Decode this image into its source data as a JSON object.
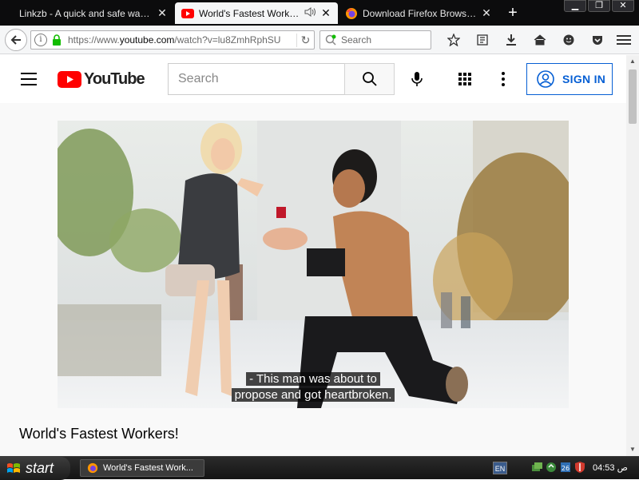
{
  "browser": {
    "tabs": [
      {
        "title": "Linkzb - A quick and safe way to ...",
        "active": false,
        "favicon": "none"
      },
      {
        "title": "World's Fastest Workers!...",
        "active": true,
        "favicon": "youtube-icon",
        "audio": true
      },
      {
        "title": "Download Firefox Browser — ...",
        "active": false,
        "favicon": "firefox-icon"
      }
    ],
    "url_prefix": "https://www.",
    "url_domain": "youtube.com",
    "url_path": "/watch?v=lu8ZmhRphSU",
    "search_placeholder": "Search",
    "window_controls": [
      "minimize",
      "restore",
      "close"
    ]
  },
  "youtube": {
    "logo_text": "YouTube",
    "search_placeholder": "Search",
    "signin_label": "SIGN IN",
    "caption_line1": "- This man was about to",
    "caption_line2": "propose and got heartbroken.",
    "video_title": "World's Fastest Workers!",
    "brand_color": "#ff0000",
    "link_color": "#065fd4"
  },
  "taskbar": {
    "start_label": "start",
    "task_item": "World's Fastest Work...",
    "language": "EN",
    "clock": "04:53 ص"
  }
}
